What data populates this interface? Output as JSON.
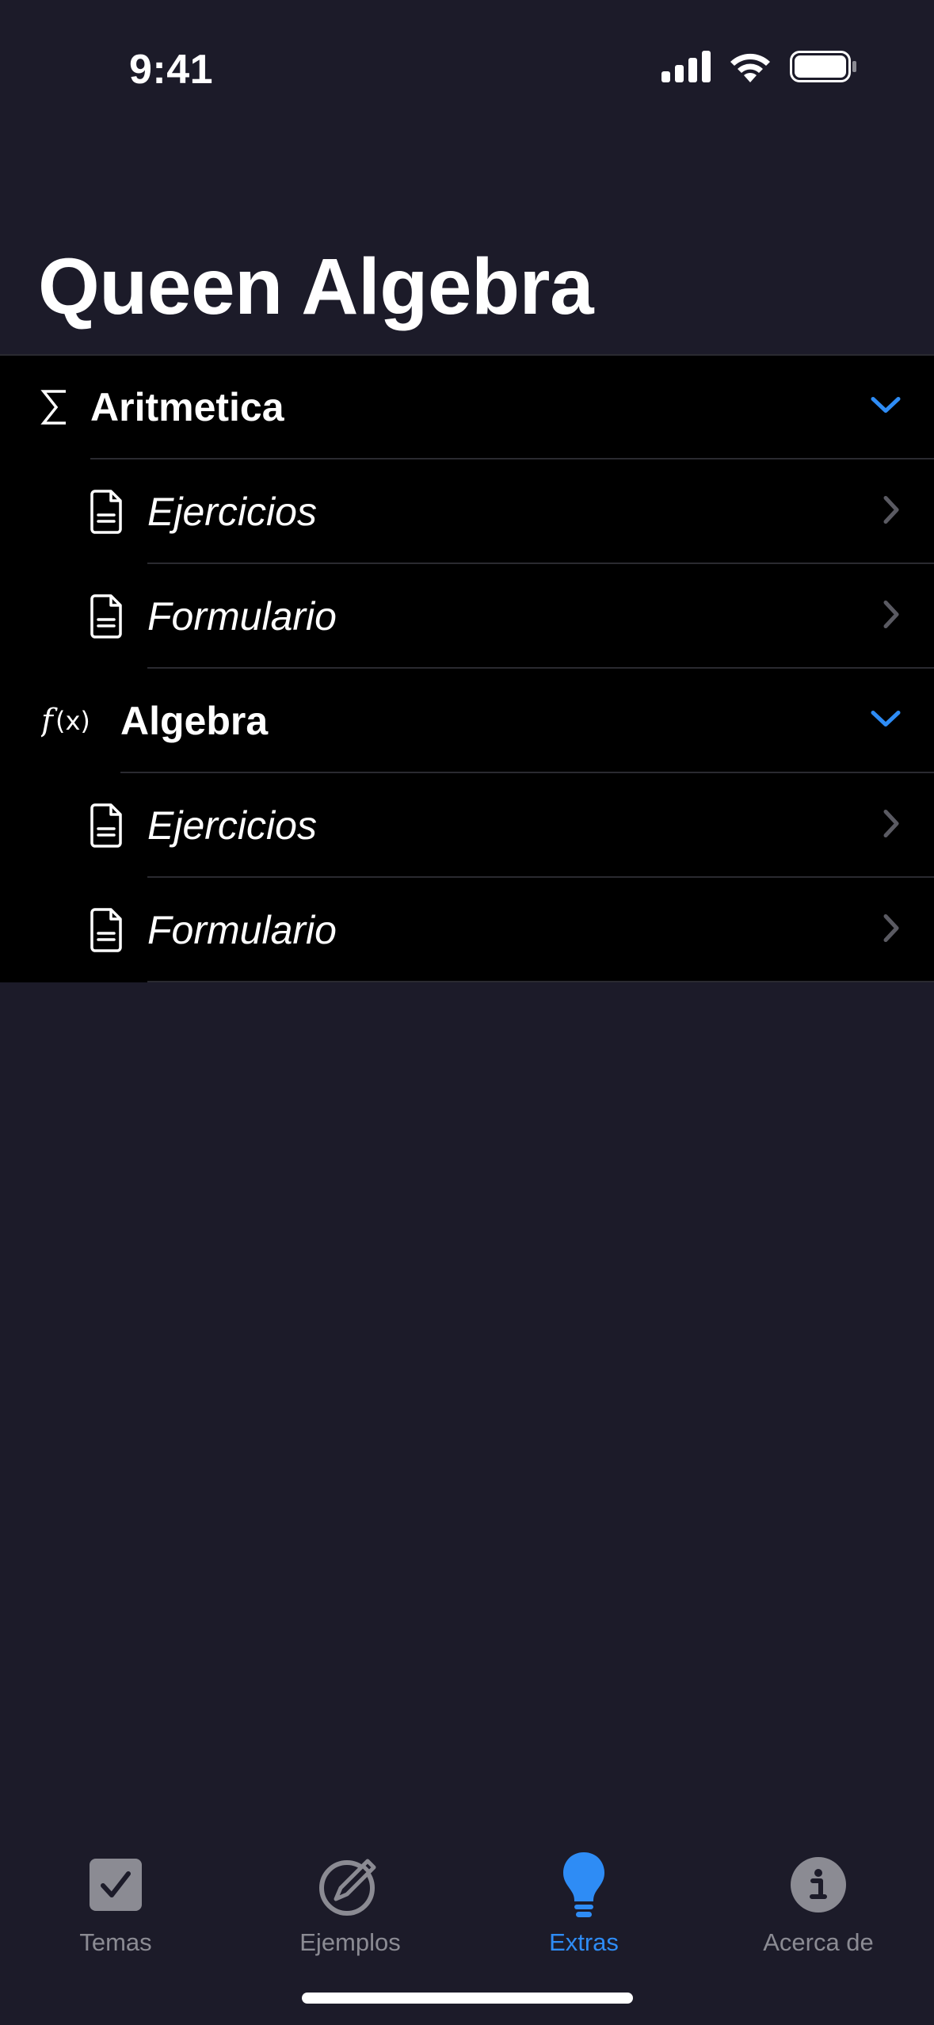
{
  "status_bar": {
    "time": "9:41"
  },
  "title": "Queen Algebra",
  "sections": [
    {
      "label": "Aritmetica",
      "icon": "sigma-icon",
      "items": [
        {
          "label": "Ejercicios",
          "icon": "document-icon"
        },
        {
          "label": "Formulario",
          "icon": "document-icon"
        }
      ]
    },
    {
      "label": "Algebra",
      "icon": "function-icon",
      "items": [
        {
          "label": "Ejercicios",
          "icon": "document-icon"
        },
        {
          "label": "Formulario",
          "icon": "document-icon"
        }
      ]
    }
  ],
  "tabs": [
    {
      "label": "Temas",
      "icon": "checkbox-icon",
      "active": false
    },
    {
      "label": "Ejemplos",
      "icon": "pencil-circle-icon",
      "active": false
    },
    {
      "label": "Extras",
      "icon": "lightbulb-icon",
      "active": true
    },
    {
      "label": "Acerca de",
      "icon": "info-icon",
      "active": false
    }
  ],
  "colors": {
    "background": "#1c1b29",
    "list_background": "#000000",
    "accent": "#2e8cf5",
    "inactive": "#8b8b93",
    "separator": "#2a2a30"
  }
}
